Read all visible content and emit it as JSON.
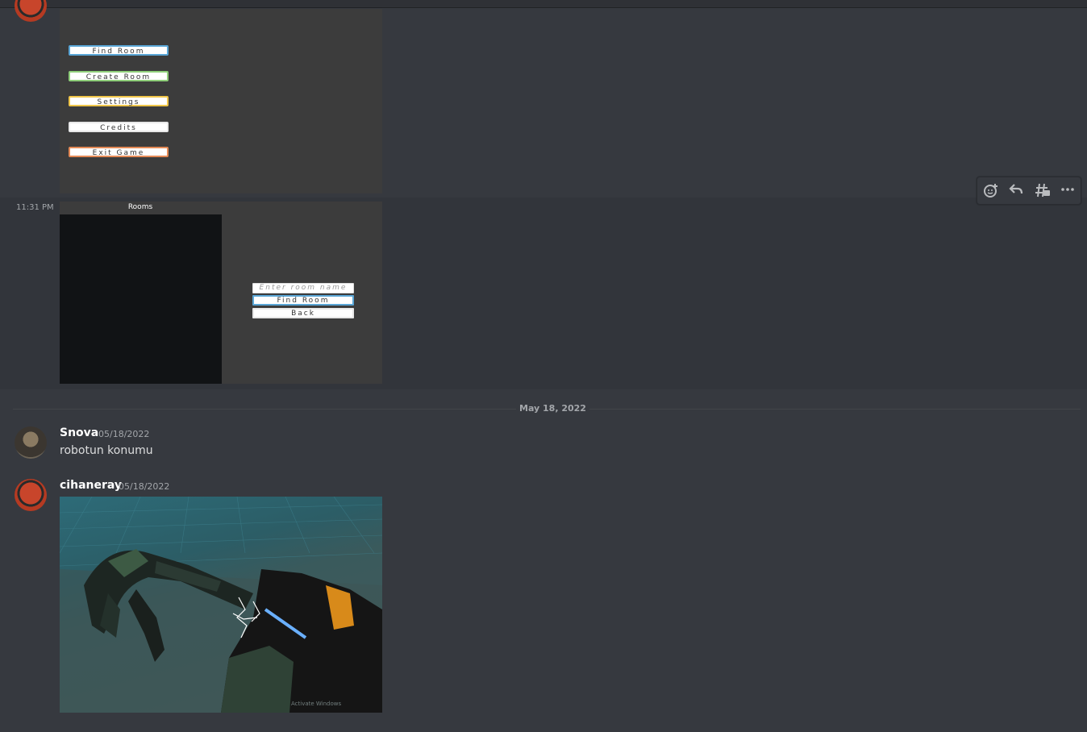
{
  "message1": {
    "menu_buttons": [
      {
        "label": "Find Room"
      },
      {
        "label": "Create Room"
      },
      {
        "label": "Settings"
      },
      {
        "label": "Credits"
      },
      {
        "label": "Exit Game"
      }
    ]
  },
  "message2": {
    "timestamp": "11:31 PM",
    "rooms_title": "Rooms",
    "input_placeholder": "Enter room name",
    "find_button": "Find Room",
    "back_button": "Back"
  },
  "toolbar": {
    "icons": [
      "add-reaction-icon",
      "reply-icon",
      "create-thread-icon",
      "more-icon"
    ]
  },
  "divider": {
    "date": "May 18, 2022"
  },
  "messages": [
    {
      "user": "Snova",
      "date": "05/18/2022",
      "text": "robotun konumu"
    },
    {
      "user": "cihaneray",
      "date": "05/18/2022",
      "attachment_watermark": "Activate Windows"
    }
  ]
}
